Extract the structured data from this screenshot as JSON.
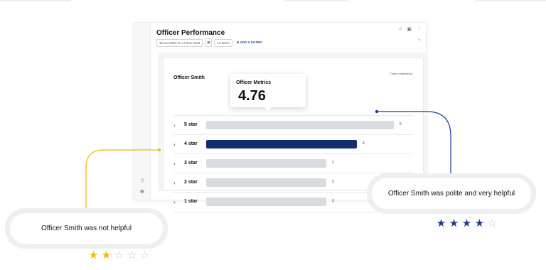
{
  "panel": {
    "title": "Officer Performance",
    "filters": {
      "date_range": "16 Oct 2023 To 17 Nov 2023",
      "items": "12 Items",
      "add_filter": "ADD A FILTER"
    }
  },
  "card": {
    "title": "Officer Smith",
    "note": "Times maintained",
    "rows": [
      {
        "label": "5 star",
        "count": "5",
        "fill": 0.97,
        "selected": false
      },
      {
        "label": "4 star",
        "count": "4",
        "fill": 0.78,
        "selected": true
      },
      {
        "label": "3 star",
        "count": "3",
        "fill": 0.62,
        "selected": false
      },
      {
        "label": "2 star",
        "count": "3",
        "fill": 0.62,
        "selected": false
      },
      {
        "label": "1 star",
        "count": "3",
        "fill": 0.62,
        "selected": false
      }
    ]
  },
  "tooltip": {
    "title": "Officer Metrics",
    "value": "4.76"
  },
  "feedback": {
    "negative": {
      "text": "Officer Smith was not helpful",
      "rating": 2,
      "color": "#f5b800"
    },
    "positive": {
      "text": "Officer Smith was polite and very helpful",
      "rating": 4,
      "color": "#1a3a8f"
    }
  },
  "colors": {
    "selected_bar": "#142d6e",
    "bar": "#d8dbe0",
    "accent_yellow": "#f5b800",
    "accent_navy": "#1a3a8f"
  }
}
